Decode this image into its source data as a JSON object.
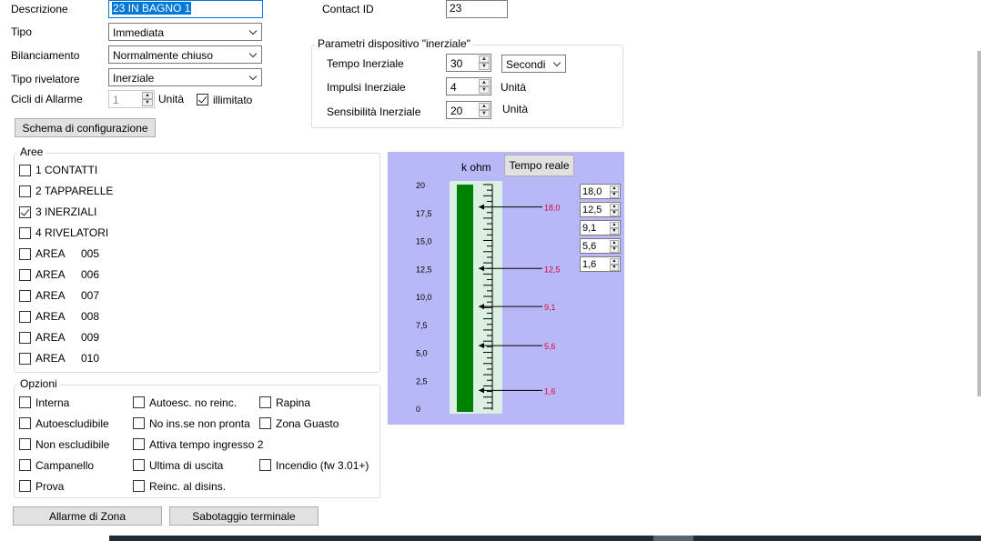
{
  "form": {
    "descrizione_label": "Descrizione",
    "descrizione_value": "23 IN BAGNO 1",
    "contact_id_label": "Contact ID",
    "contact_id_value": "23",
    "tipo_label": "Tipo",
    "tipo_value": "Immediata",
    "bilanciamento_label": "Bilanciamento",
    "bilanciamento_value": "Normalmente chiuso",
    "tipo_rivelatore_label": "Tipo rivelatore",
    "tipo_rivelatore_value": "Inerziale",
    "cicli_label": "Cicli di Allarme",
    "cicli_value": "1",
    "cicli_unit": "Unità",
    "illimitato_label": "illimitato",
    "illimitato_checked": true,
    "schema_button": "Schema di configurazione"
  },
  "inerziale": {
    "title": "Parametri dispositivo \"inerziale\"",
    "tempo_label": "Tempo Inerziale",
    "tempo_value": "30",
    "tempo_unit": "Secondi",
    "impulsi_label": "Impulsi Inerziale",
    "impulsi_value": "4",
    "impulsi_unit": "Unità",
    "sensibilita_label": "Sensibilità Inerziale",
    "sensibilita_value": "20",
    "sensibilita_unit": "Unità"
  },
  "aree": {
    "title": "Aree",
    "items": [
      {
        "label": "1 CONTATTI",
        "num": "",
        "checked": false
      },
      {
        "label": "2 TAPPARELLE",
        "num": "",
        "checked": false
      },
      {
        "label": "3 INERZIALI",
        "num": "",
        "checked": true
      },
      {
        "label": "4 RIVELATORI",
        "num": "",
        "checked": false
      },
      {
        "label": "AREA",
        "num": "005",
        "checked": false
      },
      {
        "label": "AREA",
        "num": "006",
        "checked": false
      },
      {
        "label": "AREA",
        "num": "007",
        "checked": false
      },
      {
        "label": "AREA",
        "num": "008",
        "checked": false
      },
      {
        "label": "AREA",
        "num": "009",
        "checked": false
      },
      {
        "label": "AREA",
        "num": "010",
        "checked": false
      }
    ]
  },
  "opzioni": {
    "title": "Opzioni",
    "columns": [
      [
        {
          "label": "Interna",
          "checked": false
        },
        {
          "label": "Autoescludibile",
          "checked": false
        },
        {
          "label": "Non escludibile",
          "checked": false
        },
        {
          "label": "Campanello",
          "checked": false
        },
        {
          "label": "Prova",
          "checked": false
        }
      ],
      [
        {
          "label": "Autoesc. no reinc.",
          "checked": false
        },
        {
          "label": "No ins.se non pronta",
          "checked": false
        },
        {
          "label": "Attiva tempo ingresso 2",
          "checked": false
        },
        {
          "label": "Ultima di uscita",
          "checked": false
        },
        {
          "label": "Reinc. al disins.",
          "checked": false
        }
      ],
      [
        {
          "label": "Rapina",
          "checked": false
        },
        {
          "label": "Zona Guasto",
          "checked": false
        },
        {
          "label": "",
          "checked": null
        },
        {
          "label": "Incendio (fw 3.01+)",
          "checked": false
        }
      ]
    ]
  },
  "buttons": {
    "allarme_zona": "Allarme di Zona",
    "sabotaggio": "Sabotaggio terminale"
  },
  "meter": {
    "unit_label": "k ohm",
    "realtime_button": "Tempo reale",
    "scale_max": 20,
    "scale_labels": [
      "20",
      "17,5",
      "15,0",
      "12,5",
      "10,0",
      "7,5",
      "5,0",
      "2,5",
      "0"
    ],
    "fill_fraction": 1.0,
    "fill_color": "#008000",
    "marker_color": "#e0003c",
    "thresholds": [
      {
        "value": 18.0,
        "label": "18,0",
        "input": "18,0"
      },
      {
        "value": 12.5,
        "label": "12,5",
        "input": "12,5"
      },
      {
        "value": 9.1,
        "label": "9,1",
        "input": "9,1"
      },
      {
        "value": 5.6,
        "label": "5,6",
        "input": "5,6"
      },
      {
        "value": 1.6,
        "label": "1,6",
        "input": "1,6"
      }
    ]
  }
}
